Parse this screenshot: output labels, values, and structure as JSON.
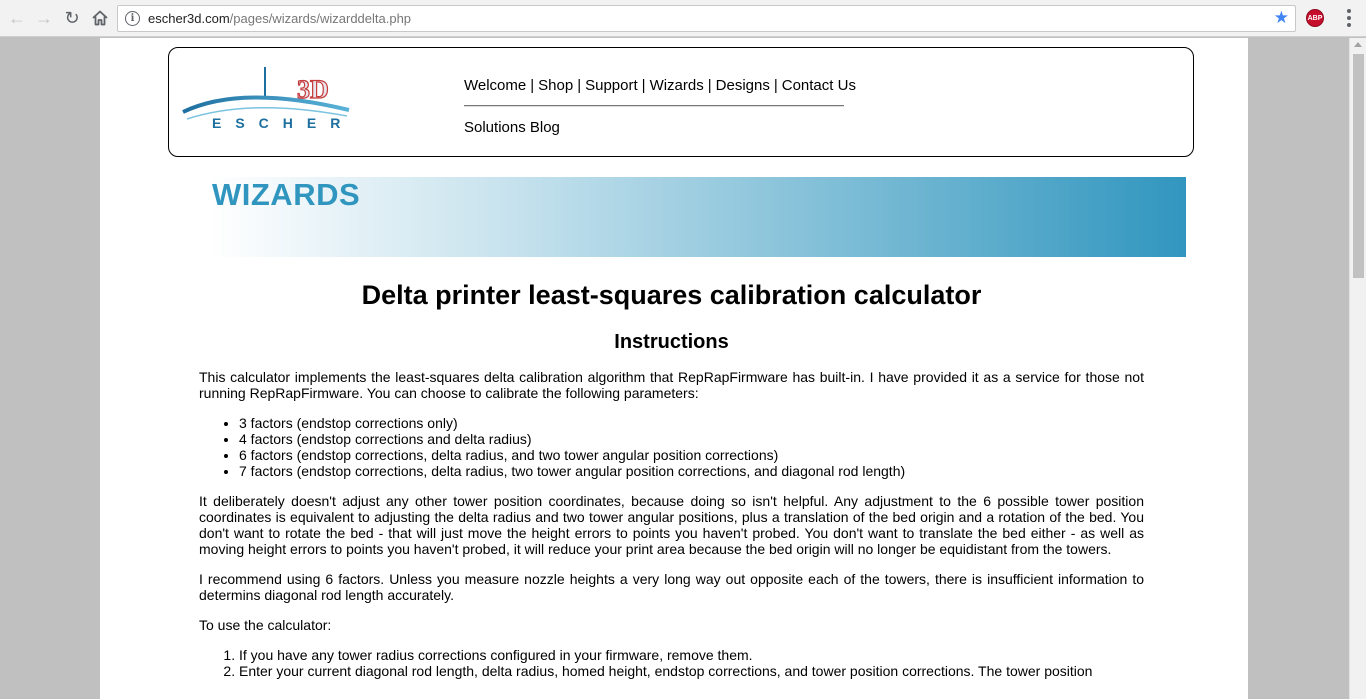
{
  "browser": {
    "url_host": "escher3d.com",
    "url_path": "/pages/wizards/wizarddelta.php",
    "extension_badge": "ABP"
  },
  "header": {
    "logo_text": "ESCHER",
    "logo_3d": "3D",
    "nav": [
      "Welcome",
      "Shop",
      "Support",
      "Wizards",
      "Designs",
      "Contact Us"
    ],
    "nav_separator": "|",
    "blog_link": "Solutions Blog"
  },
  "banner": {
    "title": "WIZARDS"
  },
  "main": {
    "title": "Delta printer least-squares calibration calculator",
    "subtitle": "Instructions",
    "intro": "This calculator implements the least-squares delta calibration algorithm that RepRapFirmware has built-in. I have provided it as a service for those not running RepRapFirmware. You can choose to calibrate the following parameters:",
    "factors": [
      "3 factors (endstop corrections only)",
      "4 factors (endstop corrections and delta radius)",
      "6 factors (endstop corrections, delta radius, and two tower angular position corrections)",
      "7 factors (endstop corrections, delta radius, two tower angular position corrections, and diagonal rod length)"
    ],
    "para_adjust": "It deliberately doesn't adjust any other tower position coordinates, because doing so isn't helpful. Any adjustment to the 6 possible tower position coordinates is equivalent to adjusting the delta radius and two tower angular positions, plus a translation of the bed origin and a rotation of the bed. You don't want to rotate the bed - that will just move the height errors to points you haven't probed. You don't want to translate the bed either - as well as moving height errors to points you haven't probed, it will reduce your print area because the bed origin will no longer be equidistant from the towers.",
    "para_recommend": "I recommend using 6 factors. Unless you measure nozzle heights a very long way out opposite each of the towers, there is insufficient information to determins diagonal rod length accurately.",
    "para_use": "To use the calculator:",
    "steps": [
      "If you have any tower radius corrections configured in your firmware, remove them.",
      "Enter your current diagonal rod length, delta radius, homed height, endstop corrections, and tower position corrections. The tower position"
    ]
  }
}
